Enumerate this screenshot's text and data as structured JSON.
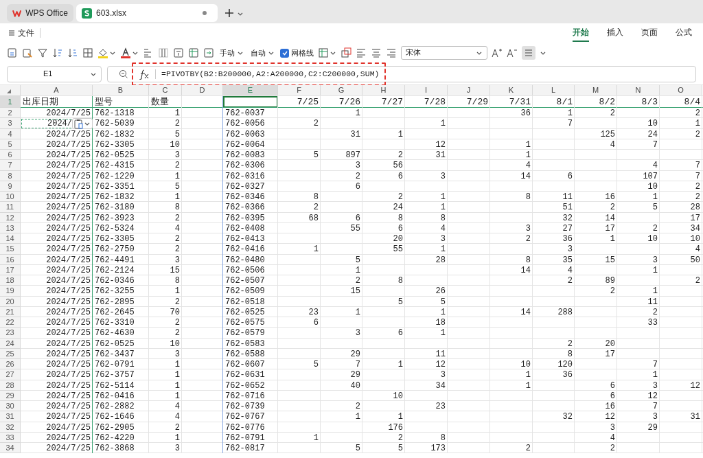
{
  "tabs": [
    {
      "label": "WPS Office",
      "kind": "home",
      "selected": false,
      "modified": false
    },
    {
      "label": "603.xlsx",
      "kind": "sheet",
      "selected": true,
      "modified": true
    }
  ],
  "menu": {
    "label": "文件"
  },
  "ribbon_tabs": [
    {
      "label": "开始",
      "selected": true
    },
    {
      "label": "插入",
      "selected": false
    },
    {
      "label": "页面",
      "selected": false
    },
    {
      "label": "公式",
      "selected": false
    }
  ],
  "toolbar": {
    "dropdowns": [
      {
        "label": "手动"
      },
      {
        "label": "自动"
      }
    ],
    "gridlines": {
      "label": "网格线",
      "checked": true
    },
    "font": {
      "value": "宋体"
    }
  },
  "formula_bar": {
    "name_box": "E1",
    "formula": "=PIVOTBY(B2:B200000,A2:A200000,C2:C200000,SUM)"
  },
  "sheet": {
    "columns": [
      {
        "letter": "A",
        "selected": false
      },
      {
        "letter": "B",
        "selected": false
      },
      {
        "letter": "C",
        "selected": false
      },
      {
        "letter": "D",
        "selected": false
      },
      {
        "letter": "E",
        "selected": true
      },
      {
        "letter": "F",
        "selected": false
      },
      {
        "letter": "G",
        "selected": false
      },
      {
        "letter": "H",
        "selected": false
      },
      {
        "letter": "I",
        "selected": false
      },
      {
        "letter": "J",
        "selected": false
      },
      {
        "letter": "K",
        "selected": false
      },
      {
        "letter": "L",
        "selected": false
      },
      {
        "letter": "M",
        "selected": false
      },
      {
        "letter": "N",
        "selected": false
      },
      {
        "letter": "O",
        "selected": false
      }
    ],
    "rows": [
      {
        "row": "1",
        "selected": true,
        "marquee": false,
        "cells": {
          "col_a": "出库日期",
          "col_b": "型号",
          "col_c": "数量",
          "col_f": "7/25",
          "col_g": "7/26",
          "col_h": "7/27",
          "col_i": "7/28",
          "col_j": "7/29",
          "col_k": "7/31",
          "col_l": "8/1",
          "col_m": "8/2",
          "col_n": "8/3",
          "col_o": "8/4"
        }
      },
      {
        "row": "2",
        "selected": false,
        "marquee": false,
        "cells": {
          "col_a": "2024/7/25",
          "col_b": "762-1318",
          "col_c": "1",
          "col_e": "762-0037",
          "col_g": "1",
          "col_k": "36",
          "col_l": "1",
          "col_m": "2",
          "col_o": "2"
        }
      },
      {
        "row": "3",
        "selected": false,
        "marquee": true,
        "cells": {
          "col_a": "2024/",
          "col_b": "762-5039",
          "col_c": "2",
          "col_e": "762-0056",
          "col_f": "2",
          "col_i": "1",
          "col_l": "7",
          "col_n": "10",
          "col_o": "1"
        }
      },
      {
        "row": "4",
        "selected": false,
        "marquee": false,
        "cells": {
          "col_a": "2024/7/25",
          "col_b": "762-1832",
          "col_c": "5",
          "col_e": "762-0063",
          "col_g": "31",
          "col_h": "1",
          "col_m": "125",
          "col_n": "24",
          "col_o": "2"
        }
      },
      {
        "row": "5",
        "selected": false,
        "marquee": false,
        "cells": {
          "col_a": "2024/7/25",
          "col_b": "762-3305",
          "col_c": "10",
          "col_e": "762-0064",
          "col_i": "12",
          "col_k": "1",
          "col_m": "4",
          "col_n": "7"
        }
      },
      {
        "row": "6",
        "selected": false,
        "marquee": false,
        "cells": {
          "col_a": "2024/7/25",
          "col_b": "762-0525",
          "col_c": "3",
          "col_e": "762-0083",
          "col_f": "5",
          "col_g": "897",
          "col_h": "2",
          "col_i": "31",
          "col_k": "1"
        }
      },
      {
        "row": "7",
        "selected": false,
        "marquee": false,
        "cells": {
          "col_a": "2024/7/25",
          "col_b": "762-4315",
          "col_c": "2",
          "col_e": "762-0306",
          "col_g": "3",
          "col_h": "56",
          "col_k": "4",
          "col_n": "4",
          "col_o": "7"
        }
      },
      {
        "row": "8",
        "selected": false,
        "marquee": false,
        "cells": {
          "col_a": "2024/7/25",
          "col_b": "762-1220",
          "col_c": "1",
          "col_e": "762-0316",
          "col_g": "2",
          "col_h": "6",
          "col_i": "3",
          "col_k": "14",
          "col_l": "6",
          "col_n": "107",
          "col_o": "7"
        }
      },
      {
        "row": "9",
        "selected": false,
        "marquee": false,
        "cells": {
          "col_a": "2024/7/25",
          "col_b": "762-3351",
          "col_c": "5",
          "col_e": "762-0327",
          "col_g": "6",
          "col_n": "10",
          "col_o": "2"
        }
      },
      {
        "row": "10",
        "selected": false,
        "marquee": false,
        "cells": {
          "col_a": "2024/7/25",
          "col_b": "762-1832",
          "col_c": "1",
          "col_e": "762-0346",
          "col_f": "8",
          "col_h": "2",
          "col_i": "1",
          "col_k": "8",
          "col_l": "11",
          "col_m": "16",
          "col_n": "1",
          "col_o": "2"
        }
      },
      {
        "row": "11",
        "selected": false,
        "marquee": false,
        "cells": {
          "col_a": "2024/7/25",
          "col_b": "762-3180",
          "col_c": "8",
          "col_e": "762-0366",
          "col_f": "2",
          "col_h": "24",
          "col_i": "1",
          "col_l": "51",
          "col_m": "2",
          "col_n": "5",
          "col_o": "28"
        }
      },
      {
        "row": "12",
        "selected": false,
        "marquee": false,
        "cells": {
          "col_a": "2024/7/25",
          "col_b": "762-3923",
          "col_c": "2",
          "col_e": "762-0395",
          "col_f": "68",
          "col_g": "6",
          "col_h": "8",
          "col_i": "8",
          "col_l": "32",
          "col_m": "14",
          "col_o": "17"
        }
      },
      {
        "row": "13",
        "selected": false,
        "marquee": false,
        "cells": {
          "col_a": "2024/7/25",
          "col_b": "762-5324",
          "col_c": "4",
          "col_e": "762-0408",
          "col_g": "55",
          "col_h": "6",
          "col_i": "4",
          "col_k": "3",
          "col_l": "27",
          "col_m": "17",
          "col_n": "2",
          "col_o": "34"
        }
      },
      {
        "row": "14",
        "selected": false,
        "marquee": false,
        "cells": {
          "col_a": "2024/7/25",
          "col_b": "762-3305",
          "col_c": "2",
          "col_e": "762-0413",
          "col_h": "20",
          "col_i": "3",
          "col_k": "2",
          "col_l": "36",
          "col_m": "1",
          "col_n": "10",
          "col_o": "10"
        }
      },
      {
        "row": "15",
        "selected": false,
        "marquee": false,
        "cells": {
          "col_a": "2024/7/25",
          "col_b": "762-2750",
          "col_c": "2",
          "col_e": "762-0416",
          "col_f": "1",
          "col_h": "55",
          "col_i": "1",
          "col_l": "3",
          "col_o": "4"
        }
      },
      {
        "row": "16",
        "selected": false,
        "marquee": false,
        "cells": {
          "col_a": "2024/7/25",
          "col_b": "762-4491",
          "col_c": "3",
          "col_e": "762-0480",
          "col_g": "5",
          "col_i": "28",
          "col_k": "8",
          "col_l": "35",
          "col_m": "15",
          "col_n": "3",
          "col_o": "50"
        }
      },
      {
        "row": "17",
        "selected": false,
        "marquee": false,
        "cells": {
          "col_a": "2024/7/25",
          "col_b": "762-2124",
          "col_c": "15",
          "col_e": "762-0506",
          "col_g": "1",
          "col_k": "14",
          "col_l": "4",
          "col_n": "1"
        }
      },
      {
        "row": "18",
        "selected": false,
        "marquee": false,
        "cells": {
          "col_a": "2024/7/25",
          "col_b": "762-0346",
          "col_c": "8",
          "col_e": "762-0507",
          "col_g": "2",
          "col_h": "8",
          "col_l": "2",
          "col_m": "89",
          "col_o": "2"
        }
      },
      {
        "row": "19",
        "selected": false,
        "marquee": false,
        "cells": {
          "col_a": "2024/7/25",
          "col_b": "762-3255",
          "col_c": "1",
          "col_e": "762-0509",
          "col_g": "15",
          "col_i": "26",
          "col_m": "2",
          "col_n": "1"
        }
      },
      {
        "row": "20",
        "selected": false,
        "marquee": false,
        "cells": {
          "col_a": "2024/7/25",
          "col_b": "762-2895",
          "col_c": "2",
          "col_e": "762-0518",
          "col_h": "5",
          "col_i": "5",
          "col_n": "11"
        }
      },
      {
        "row": "21",
        "selected": false,
        "marquee": false,
        "cells": {
          "col_a": "2024/7/25",
          "col_b": "762-2645",
          "col_c": "70",
          "col_e": "762-0525",
          "col_f": "23",
          "col_g": "1",
          "col_i": "1",
          "col_k": "14",
          "col_l": "288",
          "col_n": "2"
        }
      },
      {
        "row": "22",
        "selected": false,
        "marquee": false,
        "cells": {
          "col_a": "2024/7/25",
          "col_b": "762-3310",
          "col_c": "2",
          "col_e": "762-0575",
          "col_f": "6",
          "col_i": "18",
          "col_n": "33"
        }
      },
      {
        "row": "23",
        "selected": false,
        "marquee": false,
        "cells": {
          "col_a": "2024/7/25",
          "col_b": "762-4630",
          "col_c": "2",
          "col_e": "762-0579",
          "col_g": "3",
          "col_h": "6",
          "col_i": "1"
        }
      },
      {
        "row": "24",
        "selected": false,
        "marquee": false,
        "cells": {
          "col_a": "2024/7/25",
          "col_b": "762-0525",
          "col_c": "10",
          "col_e": "762-0583",
          "col_l": "2",
          "col_m": "20"
        }
      },
      {
        "row": "25",
        "selected": false,
        "marquee": false,
        "cells": {
          "col_a": "2024/7/25",
          "col_b": "762-3437",
          "col_c": "3",
          "col_e": "762-0588",
          "col_g": "29",
          "col_i": "11",
          "col_l": "8",
          "col_m": "17"
        }
      },
      {
        "row": "26",
        "selected": false,
        "marquee": false,
        "cells": {
          "col_a": "2024/7/25",
          "col_b": "762-0791",
          "col_c": "1",
          "col_e": "762-0607",
          "col_f": "5",
          "col_g": "7",
          "col_h": "1",
          "col_i": "12",
          "col_k": "10",
          "col_l": "120",
          "col_n": "7"
        }
      },
      {
        "row": "27",
        "selected": false,
        "marquee": false,
        "cells": {
          "col_a": "2024/7/25",
          "col_b": "762-3757",
          "col_c": "1",
          "col_e": "762-0631",
          "col_g": "29",
          "col_i": "3",
          "col_k": "1",
          "col_l": "36",
          "col_n": "1"
        }
      },
      {
        "row": "28",
        "selected": false,
        "marquee": false,
        "cells": {
          "col_a": "2024/7/25",
          "col_b": "762-5114",
          "col_c": "1",
          "col_e": "762-0652",
          "col_g": "40",
          "col_i": "34",
          "col_k": "1",
          "col_m": "6",
          "col_n": "3",
          "col_o": "12"
        }
      },
      {
        "row": "29",
        "selected": false,
        "marquee": false,
        "cells": {
          "col_a": "2024/7/25",
          "col_b": "762-0416",
          "col_c": "1",
          "col_e": "762-0716",
          "col_h": "10",
          "col_m": "6",
          "col_n": "12"
        }
      },
      {
        "row": "30",
        "selected": false,
        "marquee": false,
        "cells": {
          "col_a": "2024/7/25",
          "col_b": "762-2882",
          "col_c": "4",
          "col_e": "762-0739",
          "col_g": "2",
          "col_i": "23",
          "col_m": "16",
          "col_n": "7"
        }
      },
      {
        "row": "31",
        "selected": false,
        "marquee": false,
        "cells": {
          "col_a": "2024/7/25",
          "col_b": "762-1646",
          "col_c": "4",
          "col_e": "762-0767",
          "col_g": "1",
          "col_h": "1",
          "col_l": "32",
          "col_m": "12",
          "col_n": "3",
          "col_o": "31"
        }
      },
      {
        "row": "32",
        "selected": false,
        "marquee": false,
        "cells": {
          "col_a": "2024/7/25",
          "col_b": "762-2905",
          "col_c": "2",
          "col_e": "762-0776",
          "col_h": "176",
          "col_m": "3",
          "col_n": "29"
        }
      },
      {
        "row": "33",
        "selected": false,
        "marquee": false,
        "cells": {
          "col_a": "2024/7/25",
          "col_b": "762-4220",
          "col_c": "1",
          "col_e": "762-0791",
          "col_f": "1",
          "col_h": "2",
          "col_i": "8",
          "col_m": "4"
        }
      },
      {
        "row": "34",
        "selected": false,
        "marquee": false,
        "cells": {
          "col_a": "2024/7/25",
          "col_b": "762-3868",
          "col_c": "3",
          "col_e": "762-0817",
          "col_g": "5",
          "col_h": "5",
          "col_i": "173",
          "col_k": "2",
          "col_m": "2"
        }
      }
    ]
  }
}
